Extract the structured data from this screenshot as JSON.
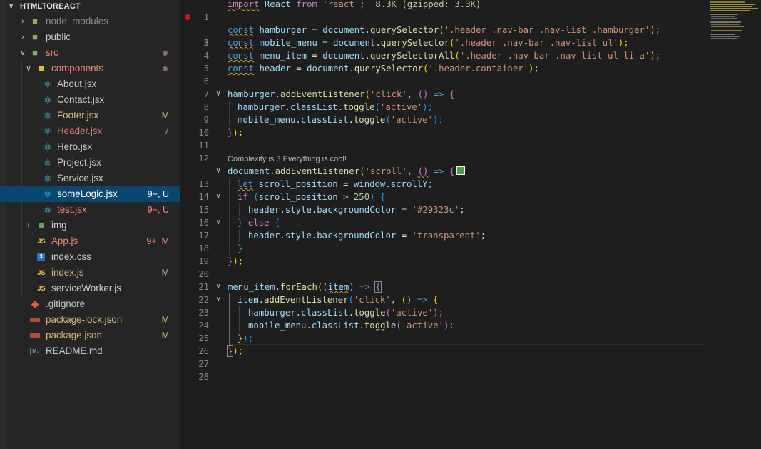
{
  "explorer": {
    "title": "HTMLTOREACT",
    "items": [
      {
        "label": "node_modules",
        "icon": "folder-icon",
        "badge": ""
      },
      {
        "label": "public",
        "icon": "folder-icon",
        "badge": ""
      },
      {
        "label": "src",
        "icon": "folder-icon",
        "badge": ""
      },
      {
        "label": "components",
        "icon": "folder-icon",
        "badge": ""
      },
      {
        "label": "About.jsx",
        "icon": "react-icon",
        "badge": ""
      },
      {
        "label": "Contact.jsx",
        "icon": "react-icon",
        "badge": ""
      },
      {
        "label": "Footer.jsx",
        "icon": "react-icon",
        "badge": "M"
      },
      {
        "label": "Header.jsx",
        "icon": "react-icon",
        "badge": "7"
      },
      {
        "label": "Hero.jsx",
        "icon": "react-icon",
        "badge": ""
      },
      {
        "label": "Project.jsx",
        "icon": "react-icon",
        "badge": ""
      },
      {
        "label": "Service.jsx",
        "icon": "react-icon",
        "badge": ""
      },
      {
        "label": "someLogic.jsx",
        "icon": "react-icon",
        "badge": "9+, U"
      },
      {
        "label": "test.jsx",
        "icon": "react-icon",
        "badge": "9+, U"
      },
      {
        "label": "img",
        "icon": "folder-icon",
        "badge": ""
      },
      {
        "label": "App.js",
        "icon": "js-icon",
        "badge": "9+, M"
      },
      {
        "label": "index.css",
        "icon": "css-icon",
        "badge": ""
      },
      {
        "label": "index.js",
        "icon": "js-icon",
        "badge": "M"
      },
      {
        "label": "serviceWorker.js",
        "icon": "js-icon",
        "badge": ""
      },
      {
        "label": ".gitignore",
        "icon": "git-icon",
        "badge": ""
      },
      {
        "label": "package-lock.json",
        "icon": "npm-icon",
        "badge": "M"
      },
      {
        "label": "package.json",
        "icon": "npm-icon",
        "badge": "M"
      },
      {
        "label": "README.md",
        "icon": "markdown-icon",
        "badge": ""
      }
    ]
  },
  "editor": {
    "line_numbers": [
      "1",
      "2",
      "3",
      "4",
      "5",
      "6",
      "7",
      "8",
      "9",
      "10",
      "11",
      "12",
      "13",
      "14",
      "15",
      "16",
      "17",
      "18",
      "19",
      "20",
      "21",
      "22",
      "23",
      "24",
      "25",
      "26",
      "27",
      "28"
    ],
    "import_size": "8.3K (gzipped: 3.3K)",
    "codelens": "Complexity is 3 Everything is cool!",
    "lines": {
      "l1": [
        "import",
        "React",
        "from",
        "'react'"
      ],
      "l3": [
        "const",
        "hamburger",
        "=",
        "document",
        ".",
        "querySelector",
        "(",
        "'.header .nav-bar .nav-list .hamburger'",
        ");"
      ],
      "l4": [
        "const",
        "mobile_menu",
        "=",
        "document",
        ".",
        "querySelector",
        "(",
        "'.header .nav-bar .nav-list ul'",
        ");"
      ],
      "l5": [
        "const",
        "menu_item",
        "=",
        "document",
        ".",
        "querySelectorAll",
        "(",
        "'.header .nav-bar .nav-list ul li a'",
        ");"
      ],
      "l6": [
        "const",
        "header",
        "=",
        "document",
        ".",
        "querySelector",
        "(",
        "'.header.container'",
        ");"
      ],
      "l8": [
        "hamburger",
        ".",
        "addEventListener",
        "(",
        "'click'",
        ", ",
        "()",
        " => ",
        "{"
      ],
      "l9": [
        "hamburger",
        ".",
        "classList",
        ".",
        "toggle",
        "(",
        "'active'",
        ");"
      ],
      "l10": [
        "mobile_menu",
        ".",
        "classList",
        ".",
        "toggle",
        "(",
        "'active'",
        ");"
      ],
      "l11": [
        "}",
        ");"
      ],
      "l13": [
        "document",
        ".",
        "addEventListener",
        "(",
        "'scroll'",
        ", ",
        "()",
        " => ",
        "{"
      ],
      "l14": [
        "let",
        "scroll_position",
        "=",
        "window",
        ".",
        "scrollY",
        ";"
      ],
      "l15": [
        "if",
        "(",
        "scroll_position",
        ">",
        "250",
        ")",
        "{"
      ],
      "l16": [
        "header",
        ".",
        "style",
        ".",
        "backgroundColor",
        "=",
        "'#29323c'",
        ";"
      ],
      "l17": [
        "}",
        "else",
        "{"
      ],
      "l18": [
        "header",
        ".",
        "style",
        ".",
        "backgroundColor",
        "=",
        "'transparent'",
        ";"
      ],
      "l19": [
        "}"
      ],
      "l20": [
        "}",
        ");"
      ],
      "l22": [
        "menu_item",
        ".",
        "forEach",
        "(",
        "(",
        "item",
        ")",
        " => ",
        "{"
      ],
      "l23": [
        "item",
        ".",
        "addEventListener",
        "(",
        "'click'",
        ", ",
        "()",
        " => ",
        "{"
      ],
      "l24": [
        "hamburger",
        ".",
        "classList",
        ".",
        "toggle",
        "(",
        "'active'",
        ");"
      ],
      "l25": [
        "mobile_menu",
        ".",
        "classList",
        ".",
        "toggle",
        "(",
        "'active'",
        ");"
      ],
      "l26": [
        "}",
        ");"
      ],
      "l27": [
        "}",
        ");"
      ]
    }
  },
  "colors": {
    "selection": "#094771",
    "sidebar_bg": "#252526",
    "editor_bg": "#1e1e1e",
    "swatch": "#4c9e4c"
  }
}
